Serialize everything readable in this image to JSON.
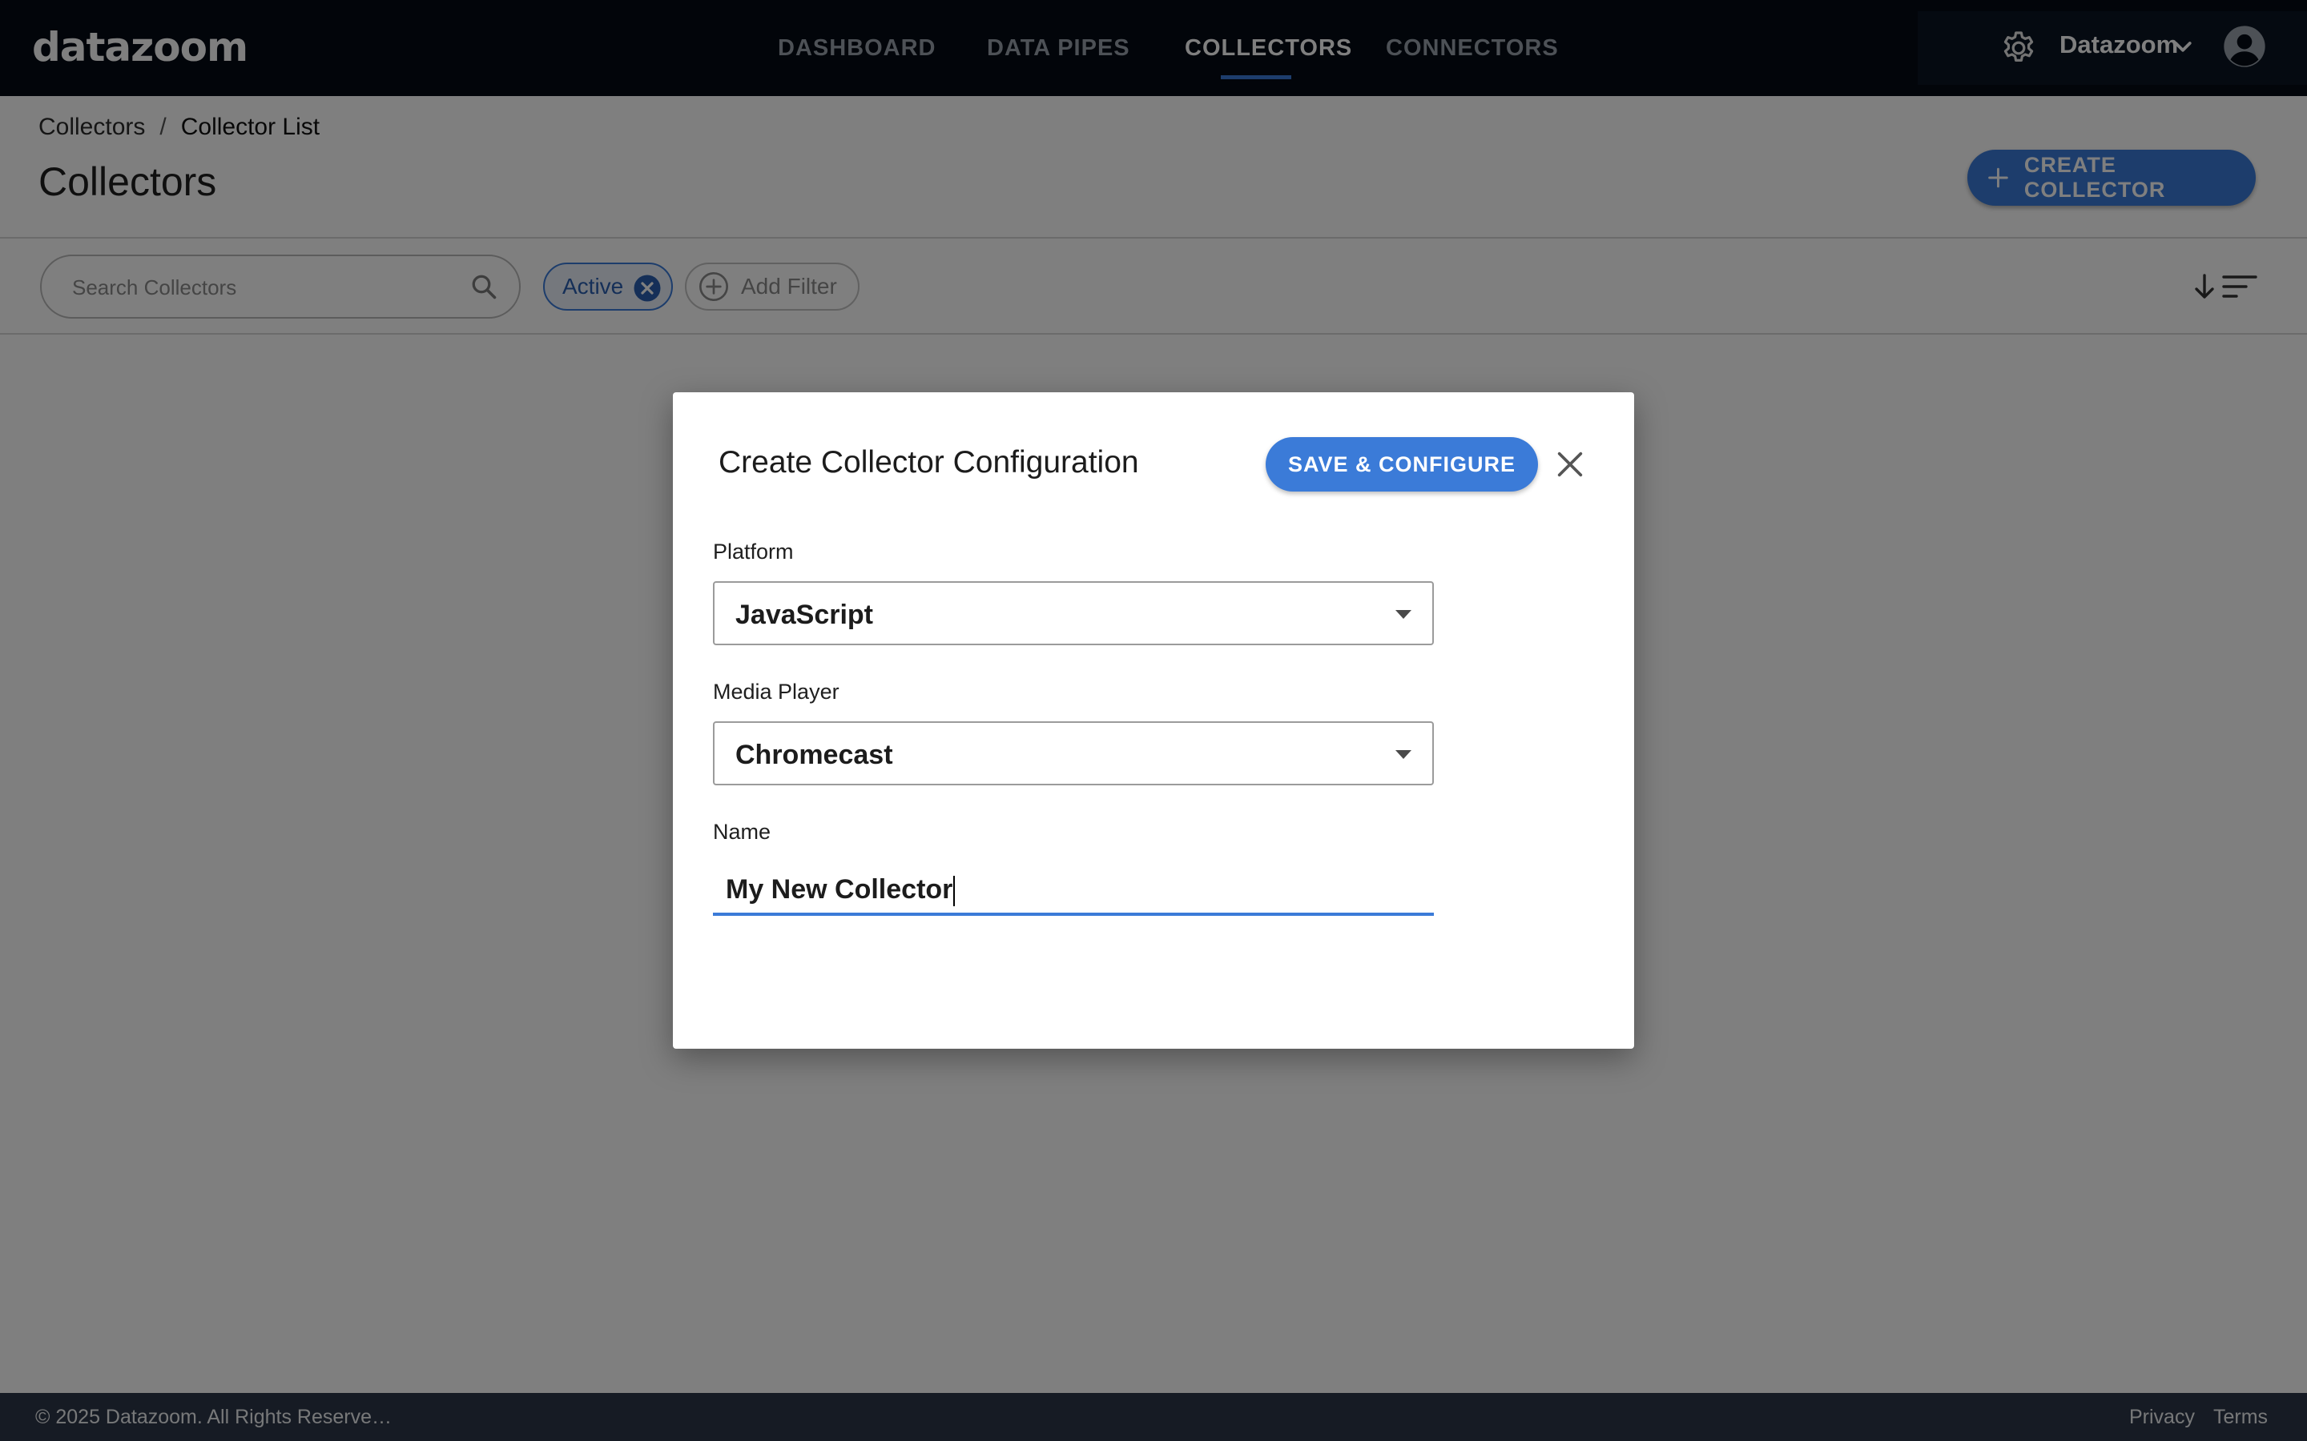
{
  "app": {
    "logo": "datazoom",
    "nav": [
      {
        "label": "DASHBOARD"
      },
      {
        "label": "DATA PIPES"
      },
      {
        "label": "COLLECTORS"
      },
      {
        "label": "CONNECTORS"
      }
    ],
    "active_nav": "COLLECTORS",
    "account_name": "Datazoom"
  },
  "page": {
    "breadcrumb": [
      "Collectors",
      "Collector List"
    ],
    "breadcrumb_separator": "/",
    "title": "Collectors",
    "create_button": "CREATE COLLECTOR"
  },
  "filters": {
    "search_placeholder": "Search Collectors",
    "active_chip": "Active",
    "add_filter": "Add Filter"
  },
  "modal": {
    "title": "Create Collector Configuration",
    "save_button": "SAVE & CONFIGURE",
    "platform_label": "Platform",
    "platform_value": "JavaScript",
    "media_player_label": "Media Player",
    "media_player_value": "Chromecast",
    "name_label": "Name",
    "name_value": "My New Collector"
  },
  "footer": {
    "copyright": "© 2025 Datazoom. All Rights Reserve…",
    "privacy": "Privacy",
    "terms": "Terms"
  },
  "colors": {
    "accent": "#3b7bd8",
    "topbar": "#050b14",
    "footer": "#2d3748"
  },
  "icons": [
    "gear-icon",
    "chevron-down-icon",
    "user-avatar-icon",
    "plus-icon",
    "search-icon",
    "close-circle-icon",
    "add-circle-icon",
    "sort-icon",
    "close-icon",
    "dropdown-arrow-icon"
  ]
}
